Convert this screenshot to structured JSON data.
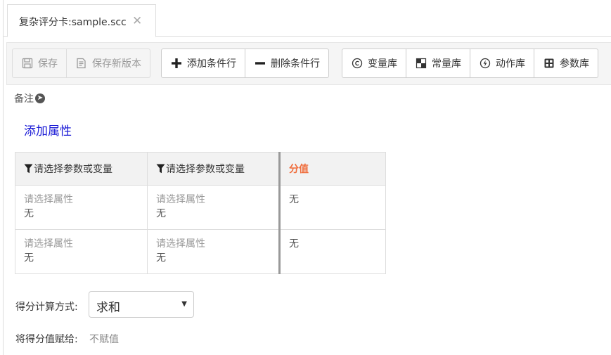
{
  "tab": {
    "title": "复杂评分卡:sample.scc",
    "close_glyph": "✕"
  },
  "toolbar": {
    "save": "保存",
    "save_new_version": "保存新版本",
    "add_condition_row": "添加条件行",
    "delete_condition_row": "删除条件行",
    "variable_lib": "变量库",
    "constant_lib": "常量库",
    "action_lib": "动作库",
    "parameter_lib": "参数库"
  },
  "note": {
    "label": "备注"
  },
  "add_attribute": "添加属性",
  "table": {
    "headers": [
      "请选择参数或变量",
      "请选择参数或变量",
      "分值"
    ],
    "score_header_color": "#f06d3c",
    "rows": [
      {
        "c1_attr": "请选择属性",
        "c1_val": "无",
        "c2_attr": "请选择属性",
        "c2_val": "无",
        "score": "无"
      },
      {
        "c1_attr": "请选择属性",
        "c1_val": "无",
        "c2_attr": "请选择属性",
        "c2_val": "无",
        "score": "无"
      }
    ]
  },
  "score_calc": {
    "label": "得分计算方式:",
    "value": "求和"
  },
  "assign": {
    "label": "将得分值赋给:",
    "value": "不赋值"
  },
  "colors": {
    "link": "#1a1ad6",
    "accent": "#f06d3c"
  }
}
